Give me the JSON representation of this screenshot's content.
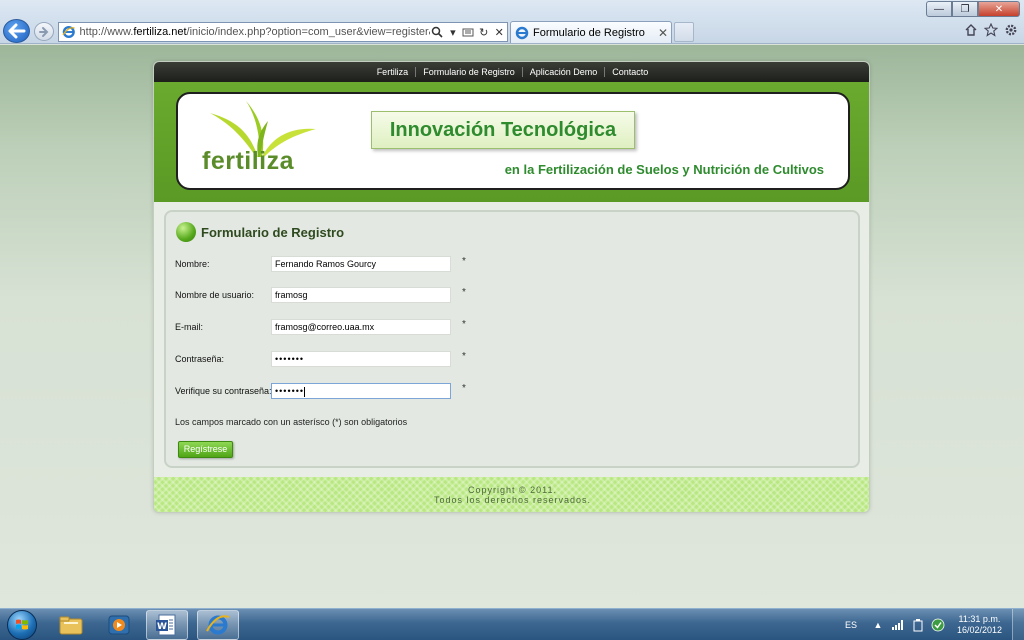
{
  "browser": {
    "url_prefix": "http://www.",
    "url_domain": "fertiliza.net",
    "url_rest": "/inicio/index.php?option=com_user&view=register&Itemid=2",
    "tab_title": "Formulario de Registro",
    "tab_close": "✕"
  },
  "site": {
    "nav": [
      "Fertiliza",
      "Formulario de Registro",
      "Aplicación Demo",
      "Contacto"
    ],
    "logo_text": "fertiliza",
    "tagline_main": "Innovación Tecnológica",
    "tagline_sub": "en la Fertilización de Suelos y Nutrición de Cultivos"
  },
  "form": {
    "title": "Formulario de Registro",
    "fields": [
      {
        "label": "Nombre:",
        "value": "Fernando Ramos Gourcy",
        "required": "*"
      },
      {
        "label": "Nombre de usuario:",
        "value": "framosg",
        "required": "*"
      },
      {
        "label": "E-mail:",
        "value": "framosg@correo.uaa.mx",
        "required": "*"
      },
      {
        "label": "Contraseña:",
        "value": "•••••••",
        "required": "*"
      },
      {
        "label": "Verifique su contraseña:",
        "value": "•••••••",
        "required": "*"
      }
    ],
    "required_note": "Los campos marcado con un asterísco (*) son obligatorios",
    "submit_label": "Regístrese"
  },
  "footer": {
    "line1": "Copyright © 2011.",
    "line2": "Todos los derechos reservados."
  },
  "taskbar": {
    "language": "ES",
    "time": "11:31 p.m.",
    "date": "16/02/2012"
  },
  "colors": {
    "brand_green": "#5a9a25",
    "tagline_green": "#2e8b2e",
    "footer_green": "#b9e883"
  }
}
